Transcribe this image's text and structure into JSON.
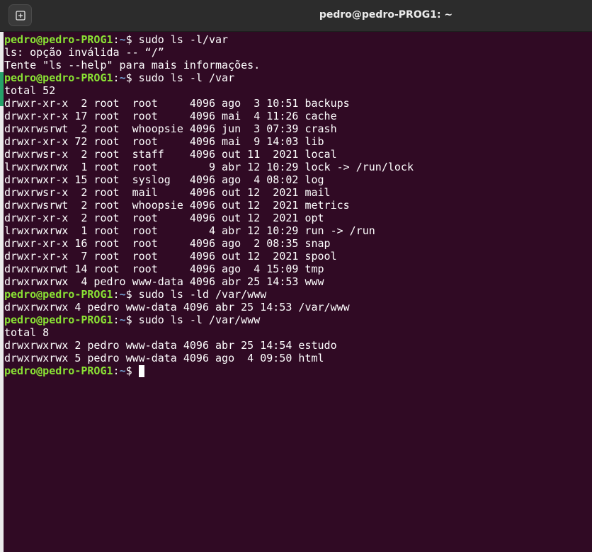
{
  "window": {
    "title": "pedro@pedro-PROG1: ~"
  },
  "colors": {
    "titlebar_bg": "#2c2c2c",
    "terminal_bg": "#300a24",
    "prompt_user": "#8ae234",
    "prompt_path": "#729fcf",
    "text": "#ffffff"
  },
  "icons": {
    "new_tab": "new-tab-icon"
  },
  "terminal": {
    "prompt_user": "pedro@pedro-PROG1",
    "prompt_colon": ":",
    "prompt_path": "~",
    "prompt_symbol": "$ ",
    "lines": [
      {
        "type": "prompt",
        "cmd": "sudo ls -l/var"
      },
      {
        "type": "out",
        "text": "ls: opção inválida -- “/”"
      },
      {
        "type": "out",
        "text": "Tente \"ls --help\" para mais informações."
      },
      {
        "type": "prompt",
        "cmd": "sudo ls -l /var"
      },
      {
        "type": "out",
        "text": "total 52"
      },
      {
        "type": "out",
        "text": "drwxr-xr-x  2 root  root     4096 ago  3 10:51 backups"
      },
      {
        "type": "out",
        "text": "drwxr-xr-x 17 root  root     4096 mai  4 11:26 cache"
      },
      {
        "type": "out",
        "text": "drwxrwsrwt  2 root  whoopsie 4096 jun  3 07:39 crash"
      },
      {
        "type": "out",
        "text": "drwxr-xr-x 72 root  root     4096 mai  9 14:03 lib"
      },
      {
        "type": "out",
        "text": "drwxrwsr-x  2 root  staff    4096 out 11  2021 local"
      },
      {
        "type": "out",
        "text": "lrwxrwxrwx  1 root  root        9 abr 12 10:29 lock -> /run/lock"
      },
      {
        "type": "out",
        "text": "drwxrwxr-x 15 root  syslog   4096 ago  4 08:02 log"
      },
      {
        "type": "out",
        "text": "drwxrwsr-x  2 root  mail     4096 out 12  2021 mail"
      },
      {
        "type": "out",
        "text": "drwxrwsrwt  2 root  whoopsie 4096 out 12  2021 metrics"
      },
      {
        "type": "out",
        "text": "drwxr-xr-x  2 root  root     4096 out 12  2021 opt"
      },
      {
        "type": "out",
        "text": "lrwxrwxrwx  1 root  root        4 abr 12 10:29 run -> /run"
      },
      {
        "type": "out",
        "text": "drwxr-xr-x 16 root  root     4096 ago  2 08:35 snap"
      },
      {
        "type": "out",
        "text": "drwxr-xr-x  7 root  root     4096 out 12  2021 spool"
      },
      {
        "type": "out",
        "text": "drwxrwxrwt 14 root  root     4096 ago  4 15:09 tmp"
      },
      {
        "type": "out",
        "text": "drwxrwxrwx  4 pedro www-data 4096 abr 25 14:53 www"
      },
      {
        "type": "prompt",
        "cmd": "sudo ls -ld /var/www"
      },
      {
        "type": "out",
        "text": "drwxrwxrwx 4 pedro www-data 4096 abr 25 14:53 /var/www"
      },
      {
        "type": "prompt",
        "cmd": "sudo ls -l /var/www"
      },
      {
        "type": "out",
        "text": "total 8"
      },
      {
        "type": "out",
        "text": "drwxrwxrwx 2 pedro www-data 4096 abr 25 14:54 estudo"
      },
      {
        "type": "out",
        "text": "drwxrwxrwx 5 pedro www-data 4096 ago  4 09:50 html"
      },
      {
        "type": "prompt",
        "cmd": "",
        "cursor": true
      }
    ]
  }
}
